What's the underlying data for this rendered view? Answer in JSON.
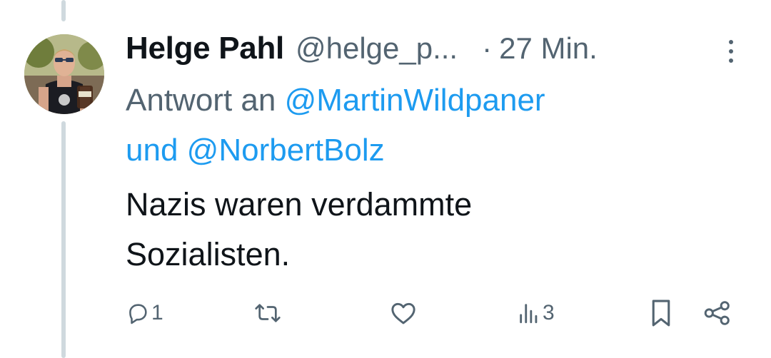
{
  "tweet": {
    "author": {
      "display_name": "Helge Pahl",
      "handle": "@helge_p...",
      "avatar_icon": "profile-photo"
    },
    "time_separator": "·",
    "time": "27 Min.",
    "reply_to": {
      "prefix": "Antwort an",
      "mention_1": "@MartinWildpaner",
      "conjunction": "und",
      "mention_2": "@NorbertBolz"
    },
    "text_line_1": "Nazis waren verdammte",
    "text_line_2": "Sozialisten.",
    "actions": {
      "reply_count": "1",
      "repost_count": "",
      "like_count": "",
      "views_count": "3"
    }
  },
  "icons": {
    "more": "more-vertical-icon",
    "reply": "reply-icon",
    "repost": "repost-icon",
    "like": "heart-icon",
    "views": "views-chart-icon",
    "bookmark": "bookmark-icon",
    "share": "share-icon"
  },
  "colors": {
    "text_primary": "#0f1419",
    "text_secondary": "#536471",
    "link": "#1d9bf0",
    "thread_line": "#cfd9de"
  }
}
